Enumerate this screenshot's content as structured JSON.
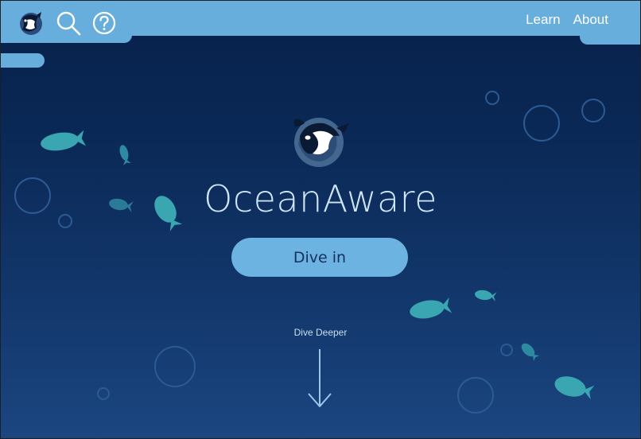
{
  "nav": {
    "learn_label": "Learn",
    "about_label": "About"
  },
  "icons": {
    "logo": "orca-logo-icon",
    "search": "search-icon",
    "help": "help-icon",
    "arrow": "arrow-down-icon"
  },
  "hero": {
    "title": "OceanAware",
    "button_label": "Dive in",
    "scroll_hint": "Dive Deeper"
  },
  "colors": {
    "bar": "#68aedd",
    "fish": "#3aa6b2",
    "bubble": "#2b5a94",
    "title": "#cfe6f7",
    "button": "#6cb3e2",
    "button_text": "#14305e"
  }
}
